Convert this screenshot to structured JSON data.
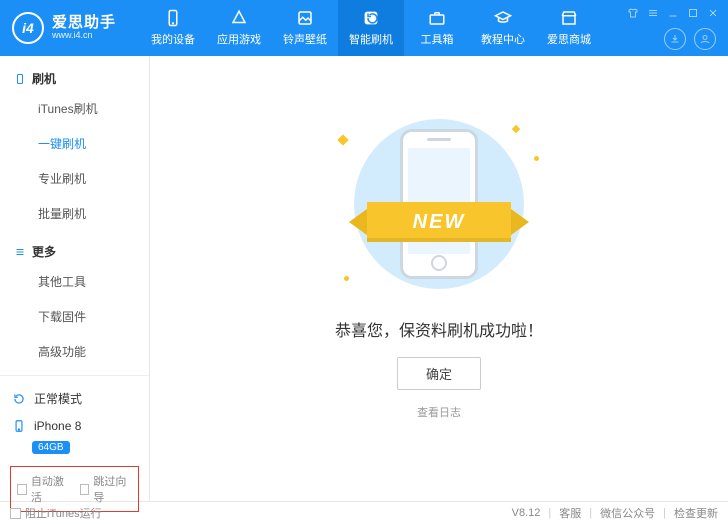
{
  "logo": {
    "badge": "i4",
    "title": "爱思助手",
    "subtitle": "www.i4.cn"
  },
  "nav": {
    "items": [
      {
        "label": "我的设备"
      },
      {
        "label": "应用游戏"
      },
      {
        "label": "铃声壁纸"
      },
      {
        "label": "智能刷机"
      },
      {
        "label": "工具箱"
      },
      {
        "label": "教程中心"
      },
      {
        "label": "爱思商城"
      }
    ]
  },
  "sidebar": {
    "section1": {
      "title": "刷机"
    },
    "flash_items": [
      {
        "label": "iTunes刷机"
      },
      {
        "label": "一键刷机"
      },
      {
        "label": "专业刷机"
      },
      {
        "label": "批量刷机"
      }
    ],
    "section2": {
      "title": "更多"
    },
    "more_items": [
      {
        "label": "其他工具"
      },
      {
        "label": "下载固件"
      },
      {
        "label": "高级功能"
      }
    ],
    "mode_label": "正常模式",
    "device_name": "iPhone 8",
    "device_storage": "64GB",
    "auto_activate": "自动激活",
    "skip_guide": "跳过向导"
  },
  "main": {
    "ribbon": "NEW",
    "success": "恭喜您，保资料刷机成功啦！",
    "ok": "确定",
    "log": "查看日志"
  },
  "footer": {
    "block_itunes": "阻止iTunes运行",
    "version": "V8.12",
    "service": "客服",
    "wechat": "微信公众号",
    "update": "检查更新"
  }
}
